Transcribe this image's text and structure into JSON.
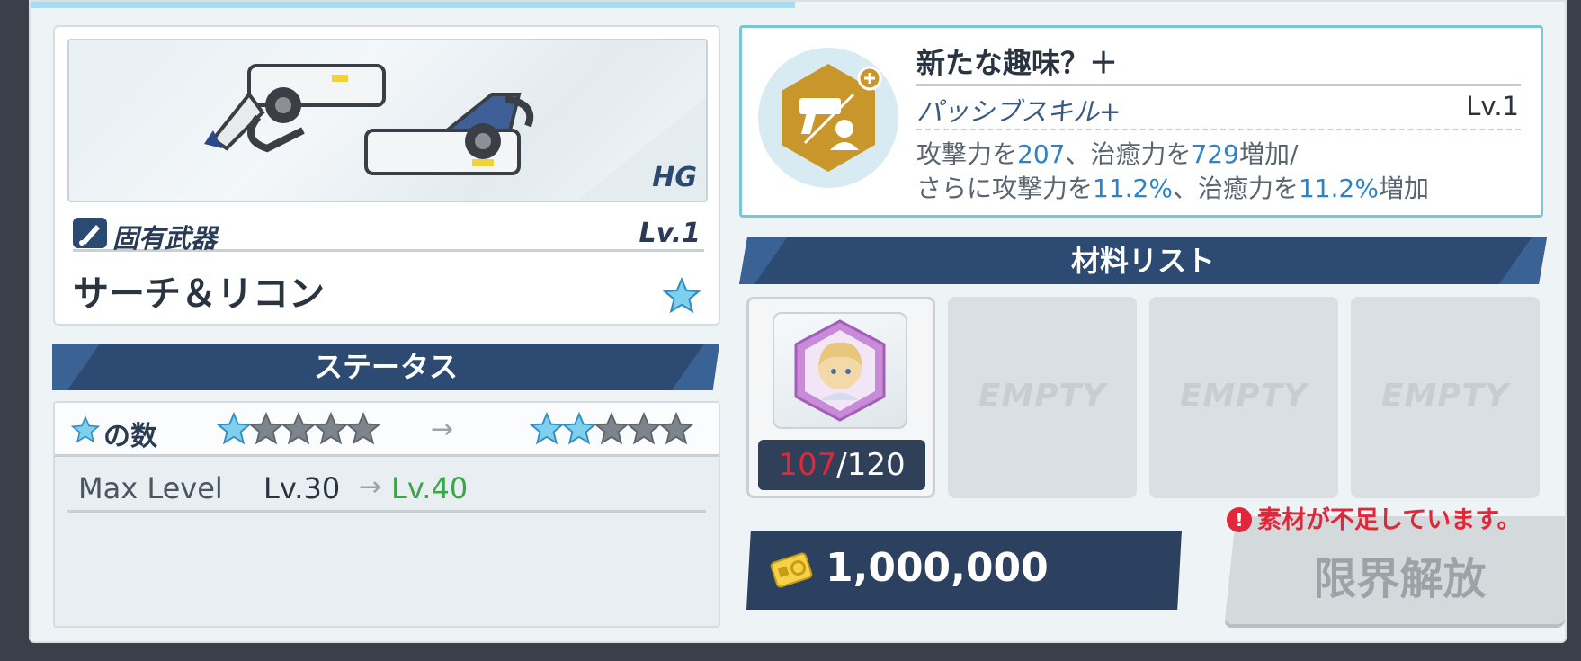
{
  "weapon": {
    "class": "HG",
    "type_label": "固有武器",
    "level": "Lv.1",
    "name": "サーチ＆リコン",
    "stars": 1
  },
  "status": {
    "header": "ステータス",
    "stars_label": "の数",
    "stars_from": 1,
    "stars_to": 2,
    "stars_max": 5,
    "arrow": "→",
    "max_level_label": "Max Level",
    "max_level_from": "Lv.30",
    "max_level_to": "Lv.40"
  },
  "skill": {
    "name": "新たな趣味？＋",
    "type": "パッシブスキル+",
    "level": "Lv.1",
    "desc1_a": "攻撃力を",
    "desc1_v1": "207",
    "desc1_b": "、治癒力を",
    "desc1_v2": "729",
    "desc1_c": "増加/",
    "desc2_a": "さらに攻撃力を",
    "desc2_v1": "11.2%",
    "desc2_b": "、治癒力を",
    "desc2_v2": "11.2%",
    "desc2_c": "増加"
  },
  "materials": {
    "header": "材料リスト",
    "slot1_have": "107",
    "slot1_need": "/120",
    "empty_label": "EMPTY"
  },
  "cost": {
    "value": "1,000,000"
  },
  "warning": "素材が不足しています。",
  "limit_button": "限界解放",
  "colors": {
    "navy": "#2c4a72",
    "highlight_blue": "#2e82c8",
    "green": "#3aa54a",
    "red": "#e0283a"
  }
}
